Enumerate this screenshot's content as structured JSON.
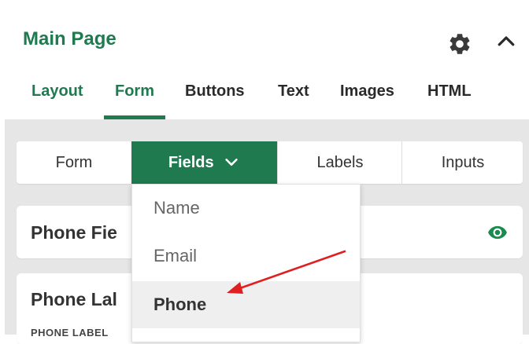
{
  "header": {
    "title": "Main Page",
    "icons": {
      "settings": "gear-icon",
      "collapse": "chevron-up-icon"
    }
  },
  "tabs": [
    {
      "label": "Layout",
      "accent": true
    },
    {
      "label": "Form",
      "active": true
    },
    {
      "label": "Buttons"
    },
    {
      "label": "Text"
    },
    {
      "label": "Images"
    },
    {
      "label": "HTML"
    }
  ],
  "subtabs": [
    {
      "label": "Form"
    },
    {
      "label": "Fields",
      "active": true,
      "icon": "chevron-down-icon"
    },
    {
      "label": "Labels"
    },
    {
      "label": "Inputs"
    }
  ],
  "dropdown": {
    "items": [
      "Name",
      "Email",
      "Phone"
    ],
    "selected": "Phone"
  },
  "cards": [
    {
      "title": "Phone Fie",
      "icon": "eye-icon"
    },
    {
      "title": "Phone Lal",
      "sublabel": "PHONE LABEL"
    }
  ],
  "colors": {
    "accent": "#1f7a4f",
    "panel_bg": "#e6e6e6",
    "eye": "#1b8a4e",
    "annotation_arrow": "#e02020"
  }
}
